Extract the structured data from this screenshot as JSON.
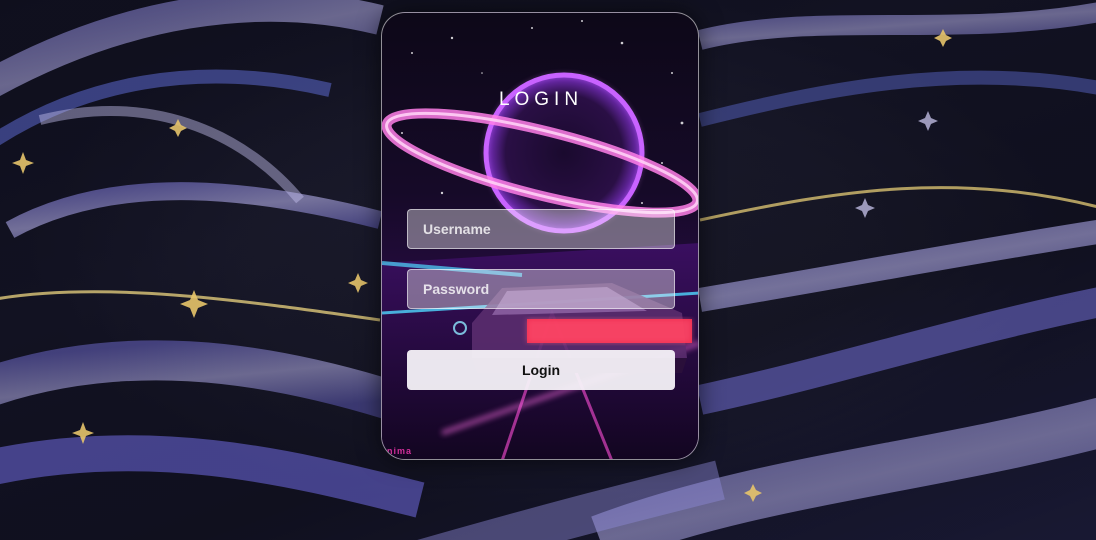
{
  "login": {
    "title": "LOGIN",
    "username_placeholder": "Username",
    "password_placeholder": "Password",
    "submit_label": "Login"
  },
  "watermark": "nima",
  "colors": {
    "neon_pink": "#ff4fd8",
    "neon_purple": "#b84cff",
    "neon_cyan": "#4fd8ff",
    "taillight_red": "#ff2a4a",
    "swirl_lavender": "#8d86d8",
    "star_gold": "#e7c46a"
  }
}
